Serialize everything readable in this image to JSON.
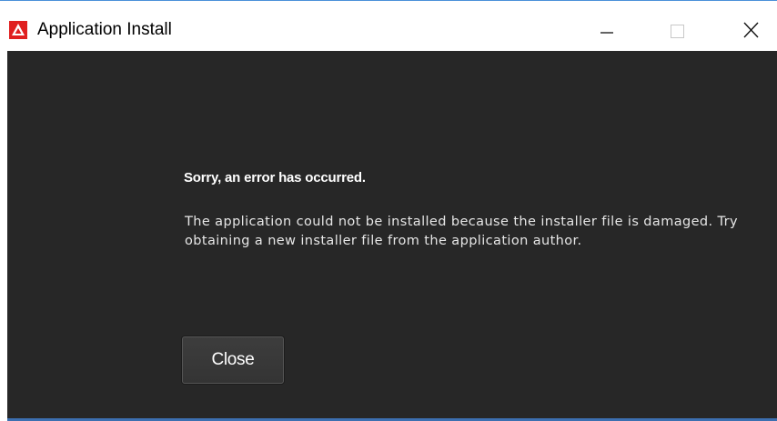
{
  "window": {
    "title": "Application Install",
    "controls": {
      "minimize": "minimize-icon",
      "maximize": "maximize-icon",
      "close": "close-icon"
    }
  },
  "dialog": {
    "heading": "Sorry, an error has occurred.",
    "message": "The application could not be installed because the installer file is damaged. Try obtaining a new installer file from the application author.",
    "close_label": "Close"
  },
  "colors": {
    "background": "#272727",
    "icon_red": "#e02020",
    "accent_blue": "#3c6fb0"
  }
}
